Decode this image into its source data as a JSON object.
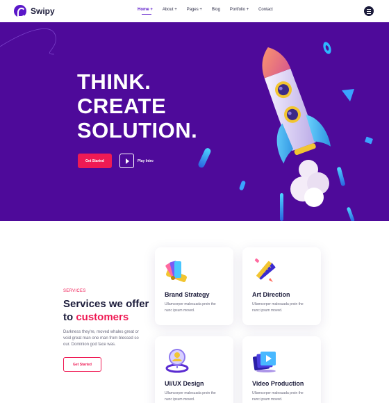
{
  "brand": {
    "name": "Swipy",
    "accent": "#5a17c9",
    "pink": "#ef1a54",
    "hero_bg": "#4e0a9a"
  },
  "nav": {
    "items": [
      "Home +",
      "About +",
      "Pages +",
      "Blog",
      "Portfolio +",
      "Contact"
    ],
    "active_index": 0
  },
  "hero": {
    "title_lines": [
      "THINK.",
      "CREATE",
      "SOLUTION."
    ],
    "cta_primary": "Get Started",
    "cta_secondary": "Play Intro"
  },
  "services": {
    "eyebrow": "SERVICES",
    "title_line1": "Services we offer",
    "title_line2_prefix": "to ",
    "title_line2_highlight": "customers",
    "description": "Darkness they're, moved whales great or void great man one man from blessed so our. Dominion god face was.",
    "cta": "Get Started",
    "cards": [
      {
        "title": "Brand Strategy",
        "text": "Ullamcorper malesuada proin the nunc ipsum moved.",
        "icon": "swatch-book-icon"
      },
      {
        "title": "Art Direction",
        "text": "Ullamcorper malesuada proin the nunc ipsum moved.",
        "icon": "ruler-pencil-icon"
      },
      {
        "title": "UI/UX Design",
        "text": "Ullamcorper malesuada proin the nunc ipsum moved.",
        "icon": "user-pin-icon"
      },
      {
        "title": "Video Production",
        "text": "Ullamcorper malesuada proin the nunc ipsum moved.",
        "icon": "video-stack-icon"
      }
    ]
  }
}
